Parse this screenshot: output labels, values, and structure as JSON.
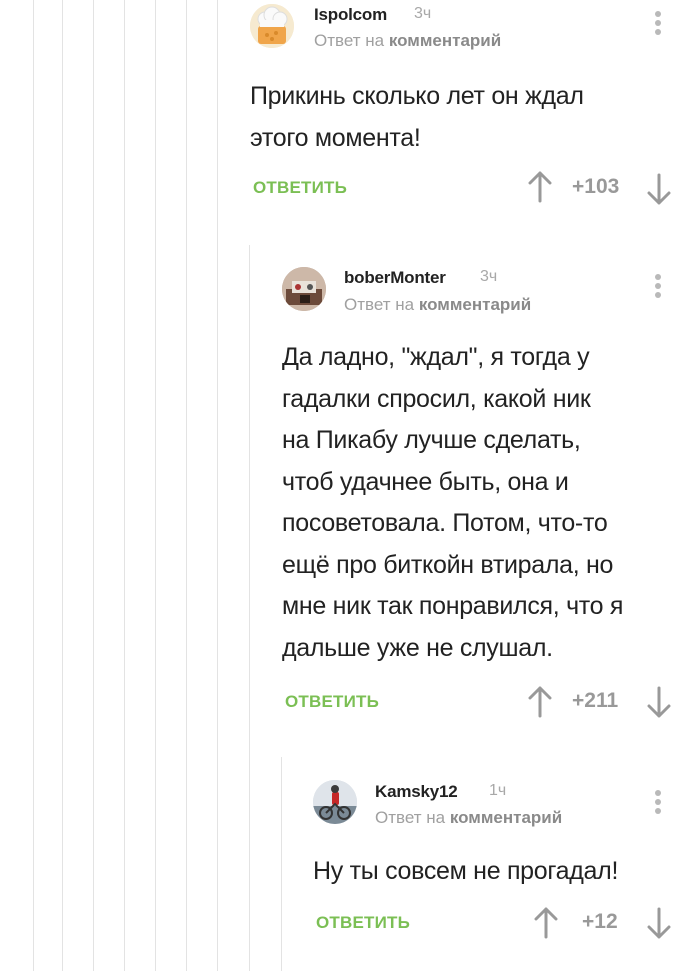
{
  "comments": [
    {
      "author": "Ispolcom",
      "time": "3ч",
      "reply_prefix": "Ответ на",
      "reply_target": "комментарий",
      "text_lines": [
        "Прикинь сколько лет он ждал",
        "этого момента!"
      ],
      "reply_label": "ОТВЕТИТЬ",
      "rating": "+103",
      "avatar_icon": "chef-hat-avatar"
    },
    {
      "author": "boberMonter",
      "time": "3ч",
      "reply_prefix": "Ответ на",
      "reply_target": "комментарий",
      "text_lines": [
        "Да ладно, \"ждал\", я тогда у",
        "гадалки спросил, какой ник",
        "на Пикабу лучше сделать,",
        "чтоб удачнее быть, она и",
        "посоветовала. Потом, что-то",
        "ещё про биткойн втирала, но",
        "мне ник так понравился, что я",
        "дальше уже не слушал."
      ],
      "reply_label": "ОТВЕТИТЬ",
      "rating": "+211",
      "avatar_icon": "photo-avatar"
    },
    {
      "author": "Kamsky12",
      "time": "1ч",
      "reply_prefix": "Ответ на",
      "reply_target": "комментарий",
      "text_lines": [
        "Ну ты совсем не прогадал!"
      ],
      "reply_label": "ОТВЕТИТЬ",
      "rating": "+12",
      "avatar_icon": "cyclist-photo-avatar"
    }
  ],
  "colors": {
    "accent_green": "#7bbf54",
    "muted_text": "#a0a0a0",
    "thread_line": "#e3e3e3"
  }
}
